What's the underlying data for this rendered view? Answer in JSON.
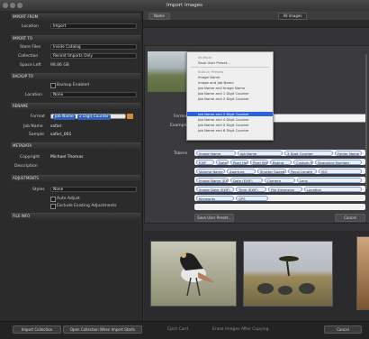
{
  "window": {
    "title": "Import Images",
    "left_label": "Import"
  },
  "toolbar": {
    "btn1": "Name",
    "btn2": "All Images"
  },
  "sidebar": {
    "sections": {
      "import_from": "IMPORT FROM",
      "import_to": "IMPORT TO",
      "backup_to": "BACKUP TO",
      "rename": "RENAME",
      "metadata": "METADATA",
      "adjustments": "ADJUSTMENTS",
      "file_info": "FILE INFO"
    },
    "location_label": "Location",
    "location_value": "Import",
    "store_files_label": "Store Files",
    "store_files_value": "Inside Catalog",
    "collection_label": "Collection",
    "collection_value": "Recent Imports Only",
    "space_left_label": "Space Left",
    "space_left_value": "98.86 GB",
    "backup_checkbox": "Backup Enabled",
    "backup_location_label": "Location",
    "backup_location_value": "None",
    "format_label": "Format",
    "format_tokens": [
      "Job Name",
      "2 Digit Counter"
    ],
    "job_name_label": "Job Name",
    "job_name_value": "safari",
    "sample_label": "Sample",
    "sample_value": "safari_001",
    "copyright_label": "Copyright",
    "copyright_value": "Michael Thomas",
    "description_label": "Description",
    "styles_label": "Styles",
    "styles_value": "None",
    "auto_adjust": "Auto Adjust",
    "exclude_existing": "Exclude Existing Adjustments"
  },
  "dialog": {
    "menu_items": [
      {
        "label": "Multiple",
        "state": "gray"
      },
      {
        "label": "Save User Preset...",
        "state": "normal"
      },
      {
        "label": "Built-in Presets",
        "state": "gray"
      },
      {
        "label": "Image Name",
        "state": "normal"
      },
      {
        "label": "Image and Job Name",
        "state": "normal"
      },
      {
        "label": "Job Name and Image Name",
        "state": "normal"
      },
      {
        "label": "Job Name and 1 Digit Counter",
        "state": "normal"
      },
      {
        "label": "Job Name and 2 Digit Counter",
        "state": "normal"
      },
      {
        "label": "Job Name and 3 Digit Counter",
        "state": "selected"
      },
      {
        "label": "Job Name and 4 Digit Counter",
        "state": "normal"
      },
      {
        "label": "Job Name and 5 Digit Counter",
        "state": "normal"
      },
      {
        "label": "Job Name and 6 Digit Counter",
        "state": "normal"
      }
    ],
    "format_label": "Format",
    "example_label": "Example",
    "tokens_label": "Tokens",
    "tokens": [
      "Image Name",
      "Job Name",
      "3 Digit Counter",
      "Folder Name",
      "EXIF",
      "Date/Time",
      "Pixel Height",
      "Pixel Width",
      "Rating",
      "Custom Name",
      "Sequence Number",
      "Volume Name",
      "Aperture",
      "Shutter Speed",
      "Focal Length",
      "ISO",
      "Image Name (EXIF)",
      "Date (EXIF)",
      "Camera",
      "Lens",
      "Image Date (EXIF)",
      "Time (EXIF)",
      "File Extension",
      "Location",
      "Keywords",
      "GPS"
    ],
    "save_preset": "Save User Preset...",
    "cancel": "Cancel"
  },
  "bottom": {
    "import_collection": "Import Collection",
    "open_collection": "Open Collection When Import Starts",
    "eject": "Eject Card",
    "erase": "Erase Images After Copying",
    "cancel": "Cancel"
  },
  "colors": {
    "accent": "#2c63d8",
    "token": "#e9eef7"
  }
}
